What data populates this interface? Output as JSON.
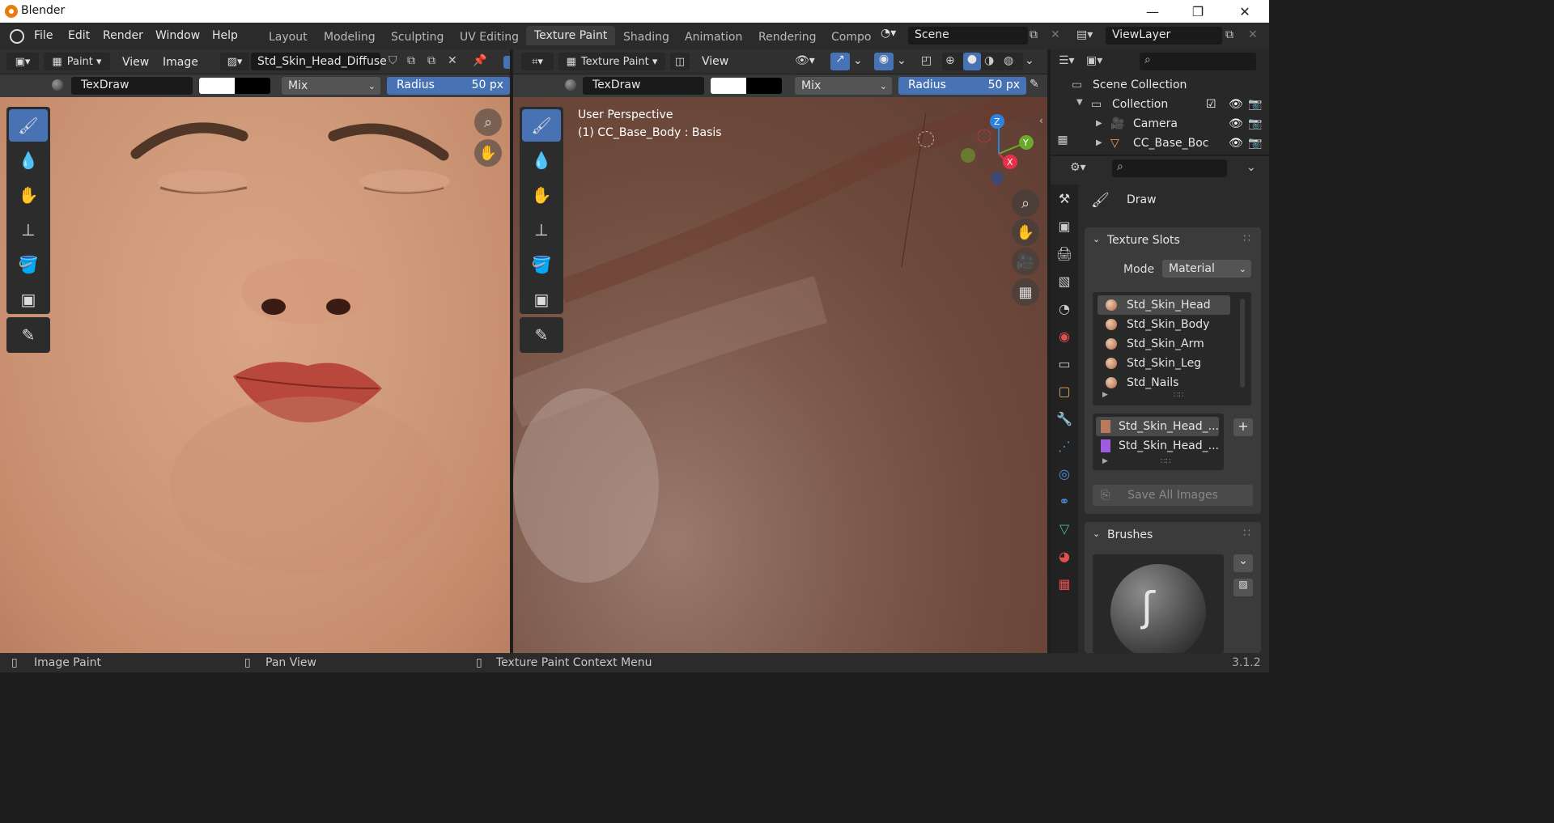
{
  "window": {
    "app_title": "Blender",
    "minimize": "—",
    "maximize": "❐",
    "close": "✕"
  },
  "menu": {
    "file": "File",
    "edit": "Edit",
    "render": "Render",
    "window": "Window",
    "help": "Help"
  },
  "workspaces": [
    "Layout",
    "Modeling",
    "Sculpting",
    "UV Editing",
    "Texture Paint",
    "Shading",
    "Animation",
    "Rendering",
    "Compo"
  ],
  "active_workspace": "Texture Paint",
  "scene": {
    "name": "Scene",
    "view_layer": "ViewLayer"
  },
  "image_editor": {
    "mode": "Paint",
    "view_menu": "View",
    "image_menu": "Image",
    "image_name": "Std_Skin_Head_Diffuse",
    "brush_name": "TexDraw",
    "blend": "Mix",
    "radius_label": "Radius",
    "radius_value": "50 px"
  },
  "viewport": {
    "mode": "Texture Paint",
    "view_menu": "View",
    "brush_name": "TexDraw",
    "blend": "Mix",
    "radius_label": "Radius",
    "radius_value": "50 px",
    "overlay_line1": "User Perspective",
    "overlay_line2": "(1) CC_Base_Body : Basis",
    "axis_x": "X",
    "axis_y": "Y",
    "axis_z": "Z"
  },
  "outliner": {
    "root": "Scene Collection",
    "collection": "Collection",
    "items": [
      "Camera",
      "CC_Base_Boc"
    ]
  },
  "properties": {
    "tool_name": "Draw",
    "texture_slots_title": "Texture Slots",
    "mode_label": "Mode",
    "mode_value": "Material",
    "materials": [
      "Std_Skin_Head",
      "Std_Skin_Body",
      "Std_Skin_Arm",
      "Std_Skin_Leg",
      "Std_Nails"
    ],
    "images": [
      "Std_Skin_Head_...",
      "Std_Skin_Head_..."
    ],
    "save_all": "Save All Images",
    "brushes_title": "Brushes"
  },
  "status": {
    "left": "Image Paint",
    "mid": "Pan View",
    "right": "Texture Paint Context Menu",
    "version": "3.1.2"
  },
  "colors": {
    "accent": "#4772b3",
    "header_bg": "#303030",
    "panel_bg": "#2b2b2b"
  }
}
